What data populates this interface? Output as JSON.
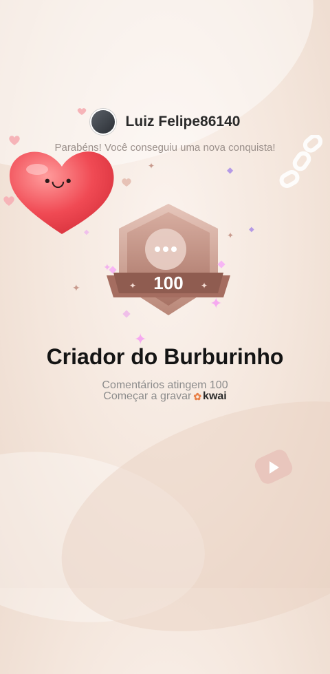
{
  "user": {
    "name": "Luiz Felipe86140"
  },
  "congrats_text": "Parabéns! Você conseguiu uma nova conquista!",
  "badge": {
    "number": "100"
  },
  "achievement": {
    "title": "Criador do Burburinho",
    "subtitle": "Comentários atingem 100"
  },
  "record": {
    "label": "Começar a gravar",
    "brand": "kwai"
  },
  "icons": {
    "heart": "heart-sticker-icon",
    "badge": "comment-badge-icon",
    "brand": "kwai-logo-icon",
    "play": "play-icon"
  },
  "colors": {
    "accent": "#e8814a",
    "badge": "#c89a8d",
    "heart": "#f2565e"
  }
}
